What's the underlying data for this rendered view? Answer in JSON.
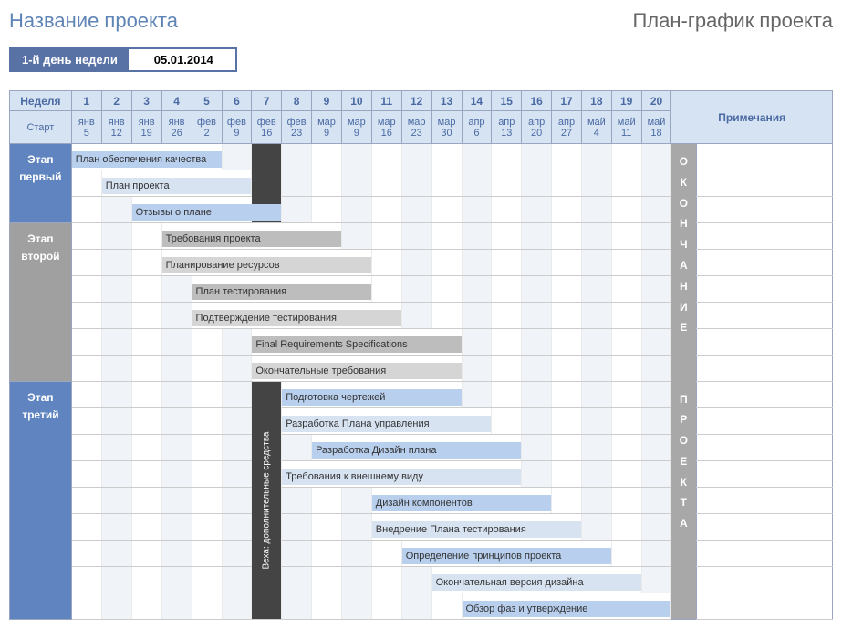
{
  "header": {
    "project_title": "Название проекта",
    "chart_title": "План-график проекта"
  },
  "week_start": {
    "label": "1-й день недели",
    "date": "05.01.2014"
  },
  "columns": {
    "week_label": "Неделя",
    "start_label": "Старт",
    "notes_label": "Примечания",
    "weeks": [
      "1",
      "2",
      "3",
      "4",
      "5",
      "6",
      "7",
      "8",
      "9",
      "10",
      "11",
      "12",
      "13",
      "14",
      "15",
      "16",
      "17",
      "18",
      "19",
      "20"
    ],
    "months": [
      "янв",
      "янв",
      "янв",
      "янв",
      "фев",
      "фев",
      "фев",
      "фев",
      "мар",
      "мар",
      "мар",
      "мар",
      "мар",
      "апр",
      "апр",
      "апр",
      "апр",
      "май",
      "май",
      "май"
    ],
    "days": [
      "5",
      "12",
      "19",
      "26",
      "2",
      "9",
      "16",
      "23",
      "9",
      "9",
      "16",
      "23",
      "30",
      "6",
      "13",
      "20",
      "27",
      "4",
      "11",
      "18"
    ]
  },
  "end_label_top": "О К О Н Ч А Н И Е",
  "end_label_bottom": "П Р О Е К Т А",
  "milestone_label": "Веха: дополнительные средства",
  "phases": [
    {
      "id": "p1",
      "title": "Этап первый",
      "style": "phase-1",
      "rows": 3
    },
    {
      "id": "p2",
      "title": "Этап второй",
      "style": "phase-2",
      "rows": 6
    },
    {
      "id": "p3",
      "title": "Этап третий",
      "style": "phase-3",
      "rows": 9
    }
  ],
  "chart_data": {
    "type": "gantt",
    "title": "План-график проекта",
    "x_unit": "week",
    "x_range": [
      1,
      20
    ],
    "week_dates": [
      {
        "w": 1,
        "label": "янв 5"
      },
      {
        "w": 2,
        "label": "янв 12"
      },
      {
        "w": 3,
        "label": "янв 19"
      },
      {
        "w": 4,
        "label": "янв 26"
      },
      {
        "w": 5,
        "label": "фев 2"
      },
      {
        "w": 6,
        "label": "фев 9"
      },
      {
        "w": 7,
        "label": "фев 16"
      },
      {
        "w": 8,
        "label": "фев 23"
      },
      {
        "w": 9,
        "label": "мар 9"
      },
      {
        "w": 10,
        "label": "мар 9"
      },
      {
        "w": 11,
        "label": "мар 16"
      },
      {
        "w": 12,
        "label": "мар 23"
      },
      {
        "w": 13,
        "label": "мар 30"
      },
      {
        "w": 14,
        "label": "апр 6"
      },
      {
        "w": 15,
        "label": "апр 13"
      },
      {
        "w": 16,
        "label": "апр 20"
      },
      {
        "w": 17,
        "label": "апр 27"
      },
      {
        "w": 18,
        "label": "май 4"
      },
      {
        "w": 19,
        "label": "май 11"
      },
      {
        "w": 20,
        "label": "май 18"
      }
    ],
    "milestones": [
      {
        "name": "Веха: дополнительные средства",
        "week": 7
      }
    ],
    "groups": [
      {
        "name": "Этап первый",
        "tasks": [
          {
            "name": "План обеспечения качества",
            "start": 1,
            "end": 5,
            "style": "bar-blue1"
          },
          {
            "name": "План проекта",
            "start": 2,
            "end": 6,
            "style": "bar-blue2"
          },
          {
            "name": "Отзывы о плане",
            "start": 3,
            "end": 7,
            "style": "bar-blue1"
          }
        ]
      },
      {
        "name": "Этап второй",
        "tasks": [
          {
            "name": "Требования проекта",
            "start": 4,
            "end": 9,
            "style": "bar-gray1"
          },
          {
            "name": "Планирование ресурсов",
            "start": 4,
            "end": 10,
            "style": "bar-gray2"
          },
          {
            "name": "План тестирования",
            "start": 5,
            "end": 10,
            "style": "bar-gray1"
          },
          {
            "name": "Подтверждение тестирования",
            "start": 5,
            "end": 11,
            "style": "bar-gray2"
          },
          {
            "name": "Final Requirements Specifications",
            "start": 7,
            "end": 13,
            "style": "bar-gray1"
          },
          {
            "name": "Окончательные требования",
            "start": 7,
            "end": 13,
            "style": "bar-gray2"
          }
        ]
      },
      {
        "name": "Этап третий",
        "tasks": [
          {
            "name": "Подготовка чертежей",
            "start": 8,
            "end": 13,
            "style": "bar-blue1"
          },
          {
            "name": "Разработка Плана управления",
            "start": 8,
            "end": 14,
            "style": "bar-blue2"
          },
          {
            "name": "Разработка Дизайн плана",
            "start": 9,
            "end": 15,
            "style": "bar-blue1"
          },
          {
            "name": "Требования к внешнему виду",
            "start": 8,
            "end": 15,
            "style": "bar-blue2"
          },
          {
            "name": "Дизайн компонентов",
            "start": 11,
            "end": 16,
            "style": "bar-blue1"
          },
          {
            "name": "Внедрение Плана тестирования",
            "start": 11,
            "end": 17,
            "style": "bar-blue2"
          },
          {
            "name": "Определение принципов проекта",
            "start": 12,
            "end": 18,
            "style": "bar-blue1"
          },
          {
            "name": "Окончательная версия дизайна",
            "start": 13,
            "end": 19,
            "style": "bar-blue2"
          },
          {
            "name": "Обзор фаз и утверждение",
            "start": 14,
            "end": 20,
            "style": "bar-blue1"
          }
        ]
      }
    ]
  }
}
